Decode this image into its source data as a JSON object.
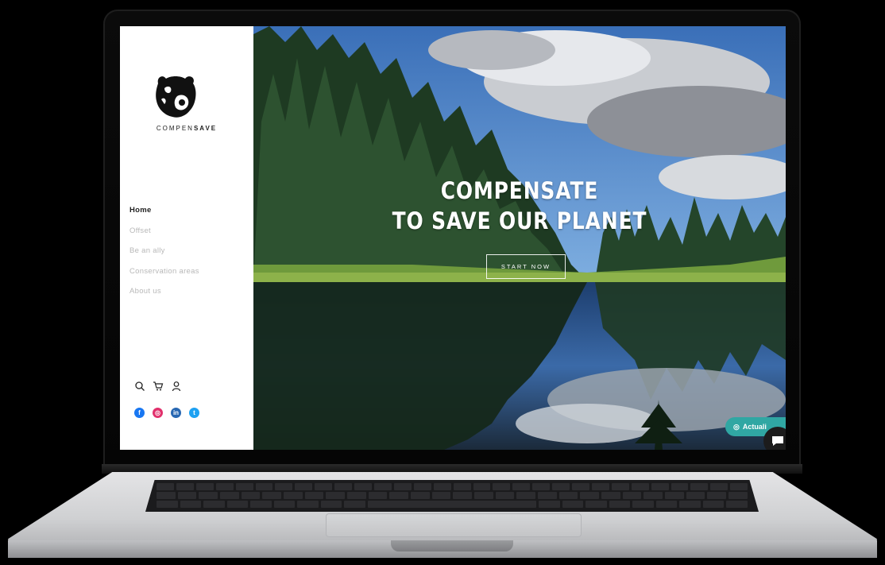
{
  "brand": {
    "name_light": "COMPEN",
    "name_bold": "SAVE",
    "logo_icon": "bear-head-icon"
  },
  "nav": {
    "items": [
      {
        "label": "Home",
        "active": true
      },
      {
        "label": "Offset",
        "active": false
      },
      {
        "label": "Be an ally",
        "active": false
      },
      {
        "label": "Conservation areas",
        "active": false
      },
      {
        "label": "About us",
        "active": false
      }
    ]
  },
  "utility_icons": [
    "search-icon",
    "cart-icon",
    "user-icon"
  ],
  "social_icons": [
    {
      "name": "facebook-icon",
      "color": "#1877f2",
      "glyph": "f"
    },
    {
      "name": "instagram-icon",
      "color": "#e1306c",
      "glyph": "◎"
    },
    {
      "name": "linkedin-icon",
      "color": "#2867b2",
      "glyph": "in"
    },
    {
      "name": "twitter-icon",
      "color": "#1da1f2",
      "glyph": "t"
    }
  ],
  "hero": {
    "headline_line1": "COMPENSATE",
    "headline_line2": "TO SAVE OUR PLANET",
    "cta_label": "START NOW"
  },
  "widgets": {
    "status_pill_label": "Actuali",
    "status_pill_color": "#30a7a3",
    "chat_icon": "chat-bubble-icon"
  }
}
